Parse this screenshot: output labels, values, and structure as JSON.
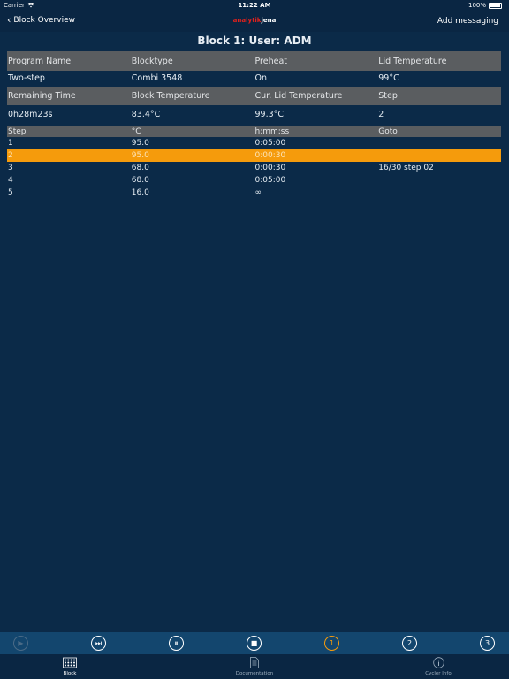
{
  "status": {
    "carrier": "Carrier",
    "time": "11:22 AM",
    "battery": "100%"
  },
  "nav": {
    "back_label": "Block Overview",
    "logo_part1": "analytik",
    "logo_part2": "jena",
    "right_label": "Add messaging"
  },
  "title": "Block 1: User: ADM",
  "program": {
    "headers": [
      "Program Name",
      "Blocktype",
      "Preheat",
      "Lid Temperature"
    ],
    "values": [
      "Two-step",
      "Combi 3548",
      "On",
      "99°C"
    ]
  },
  "run": {
    "headers": [
      "Remaining Time",
      "Block Temperature",
      "Cur. Lid Temperature",
      "Step"
    ],
    "values": [
      "0h28m23s",
      "83.4°C",
      "99.3°C",
      "2"
    ]
  },
  "steps": {
    "headers": [
      "Step",
      "°C",
      "h:mm:ss",
      "Goto"
    ],
    "rows": [
      [
        "1",
        "95.0",
        "0:05:00",
        ""
      ],
      [
        "2",
        "95.0",
        "0:00:30",
        ""
      ],
      [
        "3",
        "68.0",
        "0:00:30",
        "16/30 step 02"
      ],
      [
        "4",
        "68.0",
        "0:05:00",
        ""
      ],
      [
        "5",
        "16.0",
        "∞",
        ""
      ]
    ],
    "selected_row": 2
  },
  "player": {
    "buttons": [
      {
        "icon": "play-icon",
        "glyph": "▶",
        "state": "disabled"
      },
      {
        "icon": "skip-next-icon",
        "glyph": "⏭",
        "state": "normal"
      },
      {
        "icon": "pause-icon",
        "glyph": "⏸",
        "state": "normal"
      },
      {
        "icon": "stop-icon",
        "glyph": "■",
        "state": "normal"
      },
      {
        "icon": "block-1-icon",
        "glyph": "1",
        "state": "active"
      },
      {
        "icon": "block-2-icon",
        "glyph": "2",
        "state": "normal"
      },
      {
        "icon": "block-3-icon",
        "glyph": "3",
        "state": "normal"
      }
    ]
  },
  "tabs": {
    "block": "Block",
    "documentation": "Documentation",
    "cycler_info": "Cycler Info"
  },
  "colors": {
    "background": "#0b2a48",
    "header_row": "#5a5d60",
    "highlight": "#f59b0c",
    "logo_red": "#e2211c"
  }
}
